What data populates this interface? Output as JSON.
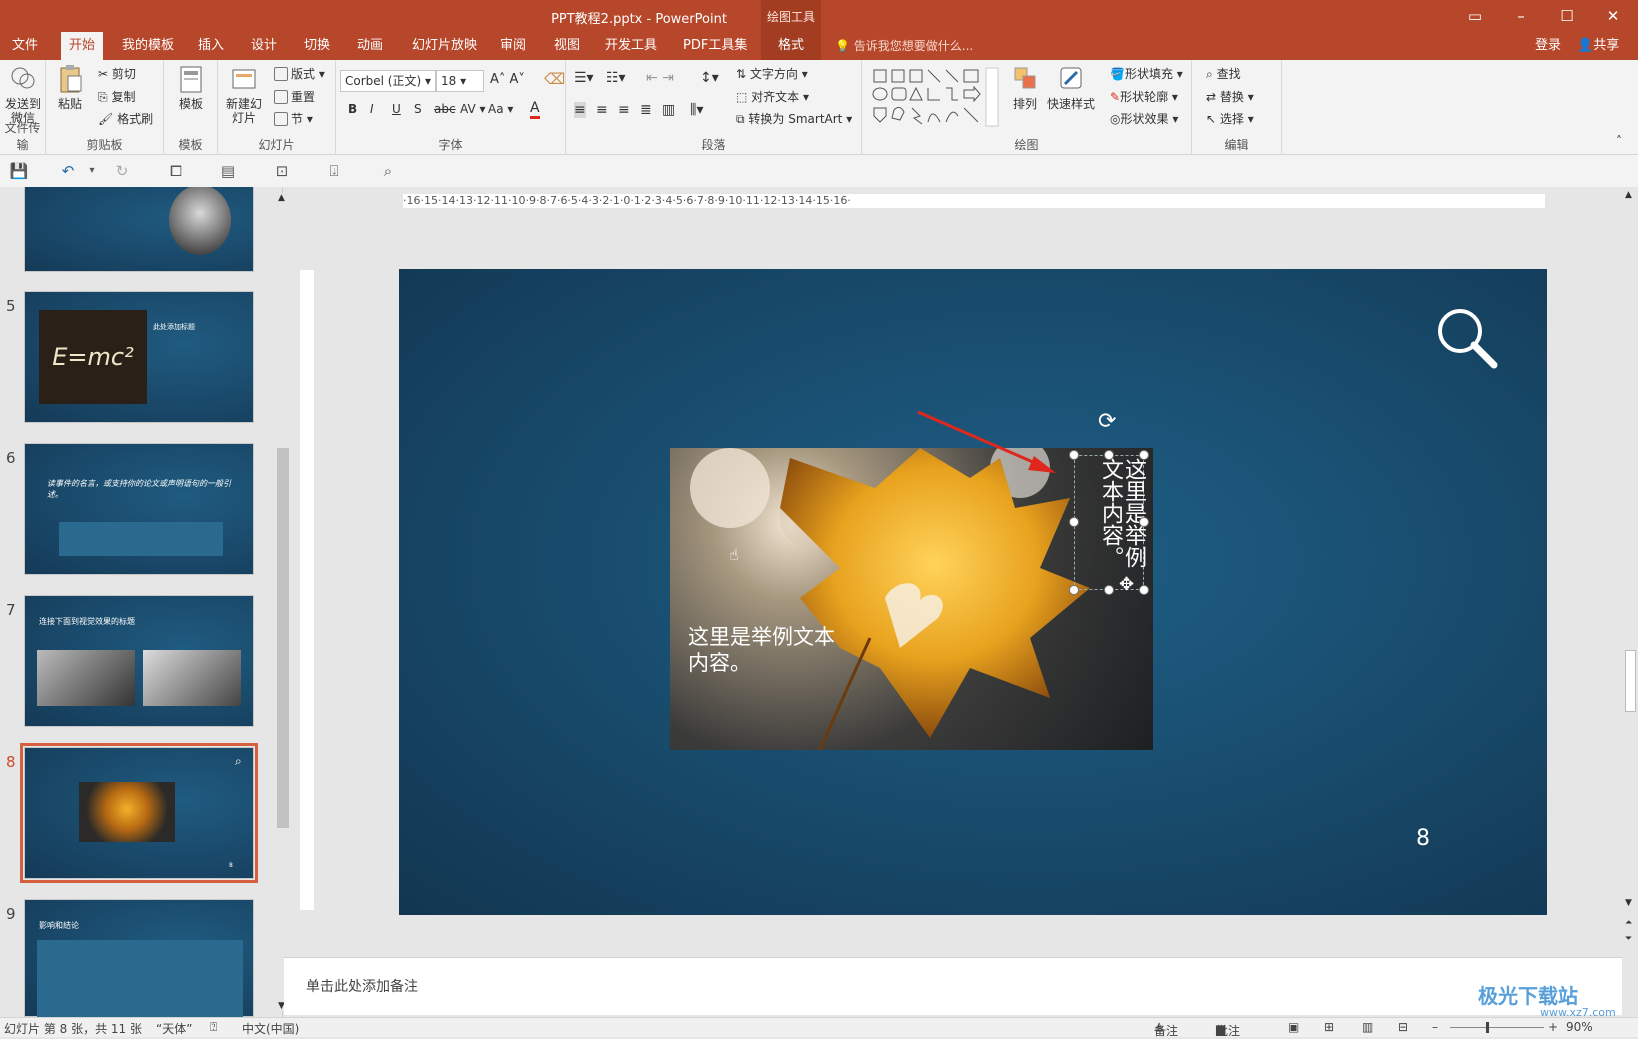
{
  "app": {
    "title": "PPT教程2.pptx - PowerPoint",
    "context_tab": "绘图工具"
  },
  "menu": {
    "tabs": [
      "文件",
      "开始",
      "我的模板",
      "插入",
      "设计",
      "切换",
      "动画",
      "幻灯片放映",
      "审阅",
      "视图",
      "开发工具",
      "PDF工具集",
      "格式"
    ],
    "active": "开始",
    "tell_me": "告诉我您想要做什么...",
    "login": "登录",
    "share": "共享"
  },
  "ribbon": {
    "groups": {
      "wechat": "文件传输",
      "clipboard": "剪贴板",
      "template": "模板",
      "slides": "幻灯片",
      "font": "字体",
      "paragraph": "段落",
      "drawing": "绘图",
      "editing": "编辑"
    },
    "send_wechat": "发送到微信",
    "paste": "粘贴",
    "cut": "剪切",
    "copy": "复制",
    "format_painter": "格式刷",
    "template_btn": "模板",
    "new_slide": "新建幻灯片",
    "layout": "版式",
    "reset": "重置",
    "section": "节",
    "font_name": "Corbel (正文)",
    "font_size": "18",
    "text_direction": "文字方向",
    "align_text": "对齐文本",
    "smartart": "转换为 SmartArt",
    "arrange": "排列",
    "quick_styles": "快速样式",
    "shape_fill": "形状填充",
    "shape_outline": "形状轮廓",
    "shape_effects": "形状效果",
    "find": "查找",
    "replace": "替换",
    "select": "选择"
  },
  "ruler": {
    "h_labels": "·16·15·14·13·12·11·10·9·8·7·6·5·4·3·2·1·0·1·2·3·4·5·6·7·8·9·10·11·12·13·14·15·16·"
  },
  "thumbnails": [
    {
      "num": "5",
      "title": "此处添加标题",
      "formula": "E=mc²"
    },
    {
      "num": "6",
      "quote": "读事件的名言，或支持你的论文或声明语句的一般引述。"
    },
    {
      "num": "7",
      "title": "连接下面到视觉效果的标题"
    },
    {
      "num": "8",
      "page": "8"
    },
    {
      "num": "9",
      "title": "影响和结论"
    }
  ],
  "slide": {
    "photo_text": "这里是举例文本内容。",
    "vertical_text": "这里是举例文本内容。",
    "page_number": "8"
  },
  "notes": {
    "placeholder": "单击此处添加备注"
  },
  "status": {
    "slide_info": "幻灯片 第 8 张，共 11 张",
    "theme": "“天体”",
    "language": "中文(中国)",
    "notes": "备注",
    "comments": "批注",
    "zoom": "90%"
  },
  "watermark": {
    "text": "极光下载站",
    "url": "www.xz7.com"
  },
  "colors": {
    "accent": "#b7472a",
    "slide_bg": "#1a4f72",
    "arrow": "#e0271e"
  }
}
